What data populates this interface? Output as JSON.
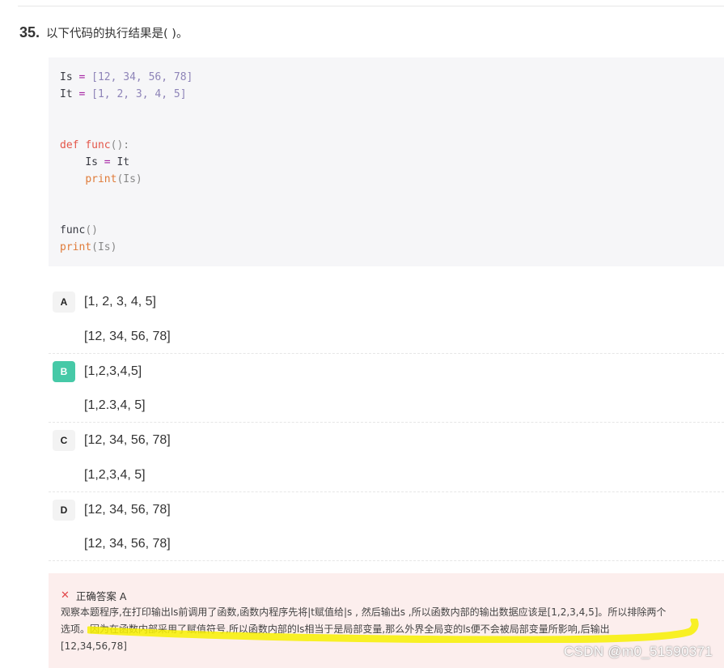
{
  "question": {
    "number": "35.",
    "text": "以下代码的执行结果是( )。"
  },
  "code": {
    "line1_var": "Is",
    "line1_eq": " = ",
    "line1_list": "[12, 34, 56, 78]",
    "line2_var": "It",
    "line2_eq": " = ",
    "line2_list": "[1, 2, 3, 4, 5]",
    "def_kw": "def",
    "func_name": "func",
    "def_sig": "():",
    "body1_indent": "    ",
    "body1_lhs": "Is",
    "body1_eq": " = ",
    "body1_rhs": "It",
    "body2_indent": "    ",
    "print_kw": "print",
    "body2_args": "(Is)",
    "call_name": "func",
    "call_parens": "()",
    "last_print": "print",
    "last_args": "(Is)"
  },
  "options": [
    {
      "letter": "A",
      "line1": "[1, 2, 3, 4, 5]",
      "line2": "[12, 34, 56, 78]",
      "selected": false
    },
    {
      "letter": "B",
      "line1": "[1,2,3,4,5]",
      "line2": "[1,2.3,4, 5]",
      "selected": true
    },
    {
      "letter": "C",
      "line1": "[12, 34, 56, 78]",
      "line2": "[1,2,3,4, 5]",
      "selected": false
    },
    {
      "letter": "D",
      "line1": "[12, 34, 56, 78]",
      "line2": "[12, 34, 56, 78]",
      "selected": false
    }
  ],
  "answer": {
    "title": "正确答案 A",
    "line1": "观察本题程序,在打印输出ls前调用了函数,函数内程序先将|t赋值给|s , 然后输出s ,所以函数内部的输出数据应该是[1,2,3,4,5]。所以排除两个",
    "line2": "选项。因为在函数内部采用了赋值符号,所以函数内部的ls相当于是局部变量,那么外界全局变的ls便不会被局部变量所影响,后输出[12,34,56,78]"
  },
  "watermark": "CSDN @m0_51590371",
  "colors": {
    "selected_badge": "#46c9a7",
    "answer_bg": "#fceeed",
    "wrong_icon": "#e2474a",
    "highlight": "#f7f000"
  },
  "icons": {
    "wrong": "close-x-icon"
  }
}
